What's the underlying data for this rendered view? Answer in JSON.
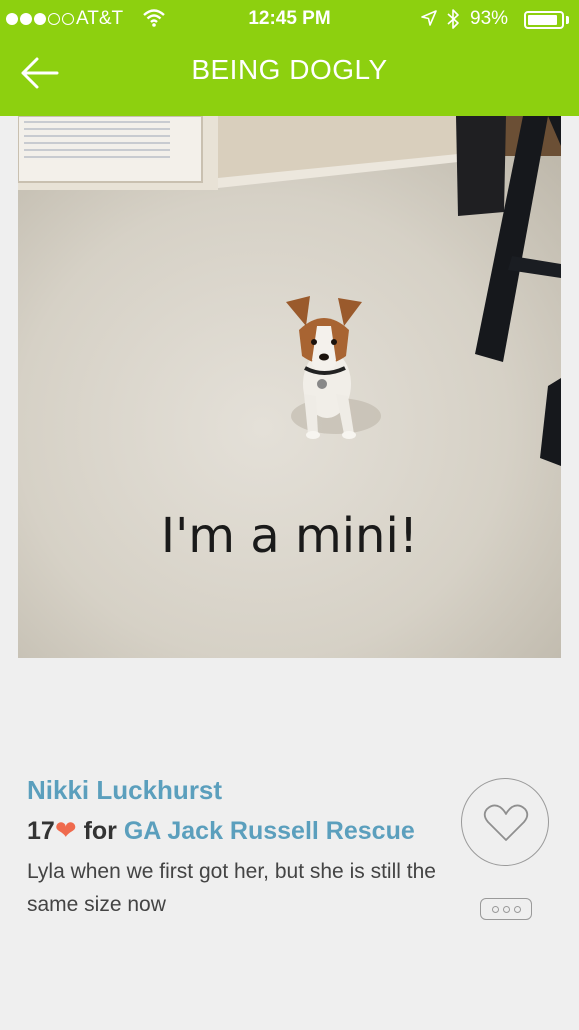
{
  "status_bar": {
    "carrier": "AT&T",
    "time": "12:45 PM",
    "battery": "93%",
    "battery_level": 0.93,
    "signal_bars": 3,
    "signal_total": 5
  },
  "nav": {
    "title": "BEING DOGLY",
    "back_icon": "arrow-left-icon"
  },
  "photo": {
    "caption": "I'm a mini!"
  },
  "post": {
    "author": "Nikki Luckhurst",
    "likes": "17",
    "for_label": "for",
    "organization": "GA Jack Russell Rescue",
    "description": "Lyla when we first got her, but she is still the same size now"
  },
  "colors": {
    "header_green": "#8dd00f",
    "link_blue": "#5b9fbd",
    "heart_orange": "#ef6a4d"
  },
  "icons": {
    "like": "heart-outline-icon",
    "more": "ellipsis-icon",
    "heart": "heart-icon"
  }
}
